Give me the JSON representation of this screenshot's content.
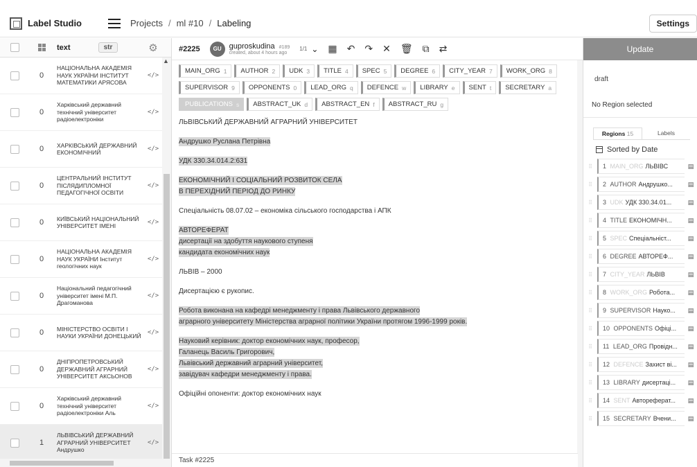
{
  "header": {
    "app_name": "Label Studio",
    "crumbs": [
      "Projects",
      "ml #10",
      "Labeling"
    ],
    "settings_label": "Settings"
  },
  "table": {
    "col_text": "text",
    "col_type": "str",
    "rows": [
      {
        "count": "0",
        "text": "НАЦІОНАЛЬНА АКАДЕМІЯ НАУК УКРАЇНИ ІНСТИТУТ МАТЕМАТИКИ АРЯСОВА",
        "selected": false
      },
      {
        "count": "0",
        "text": "Харківський державний технічний університет радіоелектроніки",
        "selected": false
      },
      {
        "count": "0",
        "text": "ХАРКІВСЬКИЙ ДЕРЖАВНИЙ ЕКОНОМІЧНИЙ",
        "selected": false
      },
      {
        "count": "0",
        "text": "ЦЕНТРАЛЬНИЙ ІНСТИТУТ ПІСЛЯДИПЛОМНОЇ ПЕДАГОГІЧНОЇ ОСВІТИ",
        "selected": false
      },
      {
        "count": "0",
        "text": "КИЇВСЬКИЙ НАЦІОНАЛЬНИЙ УНІВЕРСИТЕТ ІМЕНІ",
        "selected": false
      },
      {
        "count": "0",
        "text": "НАЦІОНАЛЬНА АКАДЕМІЯ НАУК УКРАЇНИ Інститут геологічних наук",
        "selected": false
      },
      {
        "count": "0",
        "text": "Національний педагогічний університет імені М.П. Драгоманова",
        "selected": false
      },
      {
        "count": "0",
        "text": "МІНІСТЕРСТВО ОСВІТИ І НАУКИ УКРАЇНИ ДОНЕЦЬКИЙ",
        "selected": false
      },
      {
        "count": "0",
        "text": "ДНІПРОПЕТРОВСЬКИЙ ДЕРЖАВНИЙ АГРАРНИЙ УНІВЕРСИТЕТ АКСЬОНОВ",
        "selected": false
      },
      {
        "count": "0",
        "text": "Харківський державний технічний університет радіоелектроніки Аль",
        "selected": false
      },
      {
        "count": "1",
        "text": "ЛЬВІВСЬКИЙ ДЕРЖАВНИЙ АГРАРНИЙ УНІВЕРСИТЕТ Андрушко",
        "selected": true
      }
    ]
  },
  "toolbar": {
    "task_id": "#2225",
    "avatar_initials": "GU",
    "username": "guproskudina",
    "user_num": "#189",
    "created": "created, about 4 hours ago",
    "pager": "1/1"
  },
  "labels": {
    "row1": [
      {
        "name": "MAIN_ORG",
        "key": "1",
        "active": false
      },
      {
        "name": "AUTHOR",
        "key": "2",
        "active": false
      },
      {
        "name": "UDK",
        "key": "3",
        "active": false
      },
      {
        "name": "TITLE",
        "key": "4",
        "active": false
      },
      {
        "name": "SPEC",
        "key": "5",
        "active": false
      },
      {
        "name": "DEGREE",
        "key": "6",
        "active": false
      },
      {
        "name": "CITY_YEAR",
        "key": "7",
        "active": false
      },
      {
        "name": "WORK_ORG",
        "key": "8",
        "active": false
      }
    ],
    "row2": [
      {
        "name": "SUPERVISOR",
        "key": "9",
        "active": false
      },
      {
        "name": "OPPONENTS",
        "key": "0",
        "active": false
      },
      {
        "name": "LEAD_ORG",
        "key": "q",
        "active": false
      },
      {
        "name": "DEFENCE",
        "key": "w",
        "active": false
      },
      {
        "name": "LIBRARY",
        "key": "e",
        "active": false
      },
      {
        "name": "SENT",
        "key": "t",
        "active": false
      },
      {
        "name": "SECRETARY",
        "key": "a",
        "active": false
      }
    ],
    "row3": [
      {
        "name": "PUBLICATIONS",
        "key": "s",
        "active": true
      },
      {
        "name": "ABSTRACT_UK",
        "key": "d",
        "active": false
      },
      {
        "name": "ABSTRACT_EN",
        "key": "f",
        "active": false
      },
      {
        "name": "ABSTRACT_RU",
        "key": "g",
        "active": false
      }
    ]
  },
  "document": {
    "paragraphs": [
      {
        "lines": [
          "ЛЬВІВСЬКИЙ ДЕРЖАВНИЙ АГРАРНИЙ УНІВЕРСИТЕТ"
        ],
        "highlight": false
      },
      {
        "lines": [
          "Андрушко Руслана Петрівна"
        ],
        "highlight": true
      },
      {
        "lines": [
          "УДК 330.34.014.2:631"
        ],
        "highlight": true
      },
      {
        "lines": [
          "ЕКОНОМІЧНИЙ І СОЦІАЛЬНИЙ РОЗВИТОК СЕЛА",
          "В ПЕРЕХІДНИЙ ПЕРІОД ДО РИНКУ"
        ],
        "highlight": true
      },
      {
        "lines": [
          "Спеціальність 08.07.02 – економіка сільського господарства і АПК"
        ],
        "highlight": false
      },
      {
        "lines": [
          "АВТОРЕФЕРАТ",
          "дисертації на здобуття наукового ступеня",
          "кандидата економічних наук"
        ],
        "highlight": true
      },
      {
        "lines": [
          "ЛЬВІВ – 2000"
        ],
        "highlight": false
      },
      {
        "lines": [
          "Дисертацією є рукопис."
        ],
        "highlight": false
      },
      {
        "lines": [
          "Робота виконана на кафедрі менеджменту і права Львівського державного",
          "аграрного університету Міністерства аграрної політики України протягом 1996-1999 років."
        ],
        "highlight": true
      },
      {
        "lines": [
          "Науковий керівник: доктор економічних наук, професор,",
          "Галанець Василь Григорович,",
          "Львівський державний аграрний університет,",
          "завідувач кафедри менеджменту і права."
        ],
        "highlight": true
      },
      {
        "lines": [
          "Офіційні опоненти: доктор економічних наук"
        ],
        "highlight": false
      }
    ],
    "footer_task": "Task #2225"
  },
  "side": {
    "update_label": "Update",
    "draft_label": "draft",
    "no_region": "No Region selected",
    "tab_regions": "Regions",
    "regions_count": "15",
    "tab_labels": "Labels",
    "sorted_label": "Sorted by Date",
    "regions": [
      {
        "n": "1",
        "label": "MAIN_ORG",
        "text": "ЛЬВІВС",
        "faint": true
      },
      {
        "n": "2",
        "label": "AUTHOR",
        "text": "Андрушко...",
        "faint": false
      },
      {
        "n": "3",
        "label": "UDK",
        "text": "УДК 330.34.01...",
        "faint": true
      },
      {
        "n": "4",
        "label": "TITLE",
        "text": "ЕКОНОМІЧН...",
        "faint": false
      },
      {
        "n": "5",
        "label": "SPEC",
        "text": "Спеціальніст...",
        "faint": true
      },
      {
        "n": "6",
        "label": "DEGREE",
        "text": "АВТОРЕФ...",
        "faint": false
      },
      {
        "n": "7",
        "label": "CITY_YEAR",
        "text": "ЛЬВІВ",
        "faint": true
      },
      {
        "n": "8",
        "label": "WORK_ORG",
        "text": "Робота...",
        "faint": true
      },
      {
        "n": "9",
        "label": "SUPERVISOR",
        "text": "Науко...",
        "faint": false
      },
      {
        "n": "10",
        "label": "OPPONENTS",
        "text": "Офіці...",
        "faint": false
      },
      {
        "n": "11",
        "label": "LEAD_ORG",
        "text": "Провідн...",
        "faint": false
      },
      {
        "n": "12",
        "label": "DEFENCE",
        "text": "Захист ві...",
        "faint": true
      },
      {
        "n": "13",
        "label": "LIBRARY",
        "text": "дисертаці...",
        "faint": false
      },
      {
        "n": "14",
        "label": "SENT",
        "text": "Автореферат...",
        "faint": true
      },
      {
        "n": "15",
        "label": "SECRETARY",
        "text": "Вчени...",
        "faint": false
      }
    ]
  }
}
